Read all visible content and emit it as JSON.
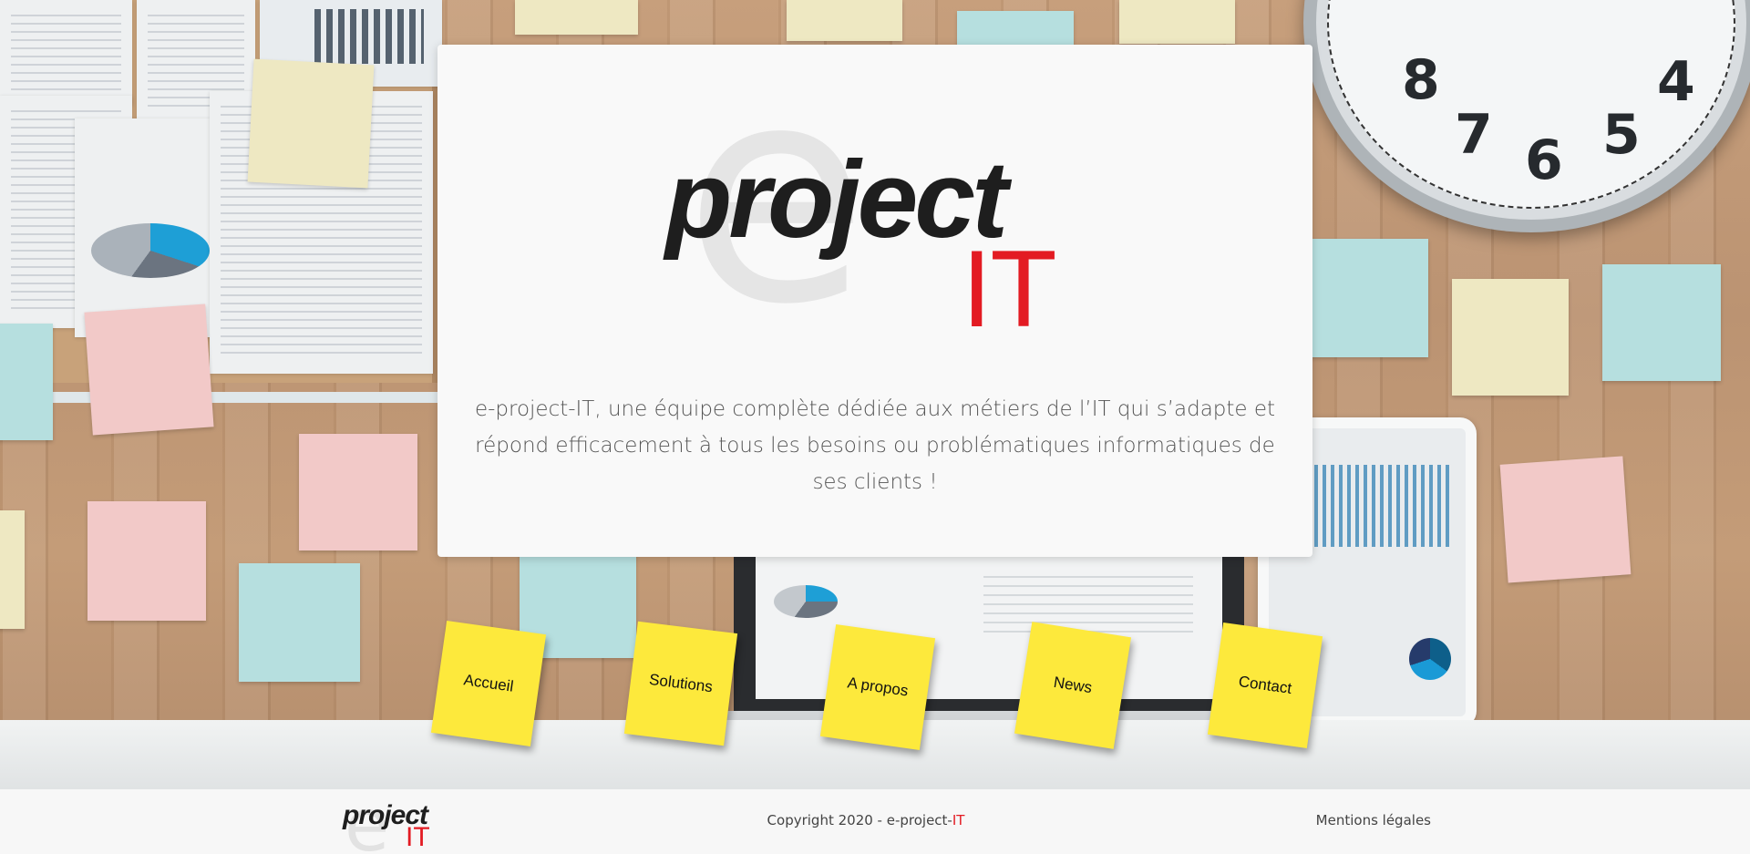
{
  "brand": {
    "logo_letter": "e",
    "logo_word": "project",
    "logo_suffix": "IT",
    "accent_color": "#e31b23",
    "note_color": "#fde93c"
  },
  "hero": {
    "tagline": "e-project-IT, une équipe complète dédiée aux métiers de l’IT qui s’adapte et répond efficacement à tous les besoins ou problématiques informatiques de ses clients !"
  },
  "nav": {
    "items": [
      {
        "label": "Accueil",
        "icon": "sticky-note"
      },
      {
        "label": "Solutions",
        "icon": "sticky-note"
      },
      {
        "label": "A propos",
        "icon": "sticky-note"
      },
      {
        "label": "News",
        "icon": "sticky-note"
      },
      {
        "label": "Contact",
        "icon": "sticky-note"
      }
    ]
  },
  "footer": {
    "copyright_prefix": "Copyright 2020 - e-project-",
    "copyright_suffix": "IT",
    "legal_label": "Mentions légales"
  }
}
